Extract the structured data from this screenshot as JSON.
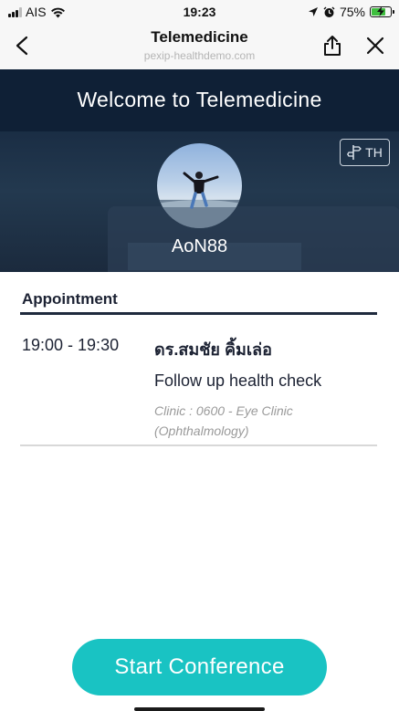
{
  "status_bar": {
    "carrier": "AIS",
    "time": "19:23",
    "battery_percent": "75%",
    "battery_level": 0.75,
    "icons": [
      "signal-icon",
      "wifi-icon",
      "location-icon",
      "alarm-icon",
      "battery-charging-icon"
    ]
  },
  "nav": {
    "title": "Telemedicine",
    "subtitle": "pexip-healthdemo.com",
    "icons": [
      "back-arrow-icon",
      "share-icon",
      "close-icon"
    ]
  },
  "hero": {
    "title": "Welcome to Telemedicine",
    "language_label": "TH",
    "username": "AoN88",
    "colors": {
      "band": "#0f2036",
      "background": "#1a2d44"
    }
  },
  "appointment": {
    "heading": "Appointment",
    "time": "19:00 - 19:30",
    "doctor": "ดร.สมชัย คิ้มเล่อ",
    "purpose": "Follow up health check",
    "clinic": "Clinic : 0600 - Eye Clinic (Ophthalmology)"
  },
  "actions": {
    "start_label": "Start Conference",
    "accent_color": "#19c3c3"
  }
}
